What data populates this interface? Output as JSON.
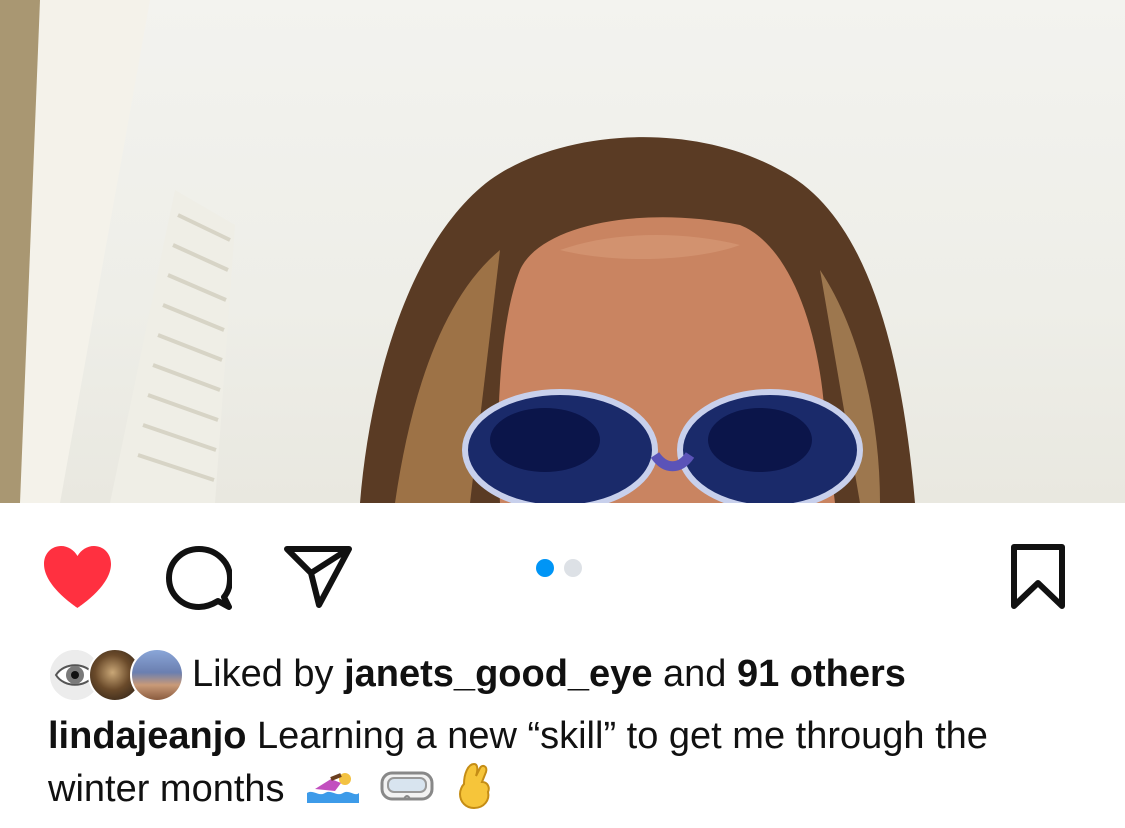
{
  "post": {
    "carousel": {
      "total": 2,
      "active_index": 0
    },
    "liked": true,
    "likes": {
      "prefix": "Liked by",
      "user": "janets_good_eye",
      "connector": "and",
      "others": "91 others"
    },
    "caption": {
      "username": "lindajeanjo",
      "text": "Learning a new “skill” to get me through the winter months"
    }
  },
  "icons": {
    "like": "heart-icon",
    "comment": "comment-icon",
    "share": "paper-plane-icon",
    "save": "bookmark-icon",
    "caption_emojis": [
      "woman-swimming-emoji",
      "goggles-emoji",
      "crossed-fingers-emoji"
    ]
  },
  "colors": {
    "like_red": "#ff3040",
    "carousel_active": "#0095f6",
    "carousel_inactive": "#dde1e6",
    "text": "#111111"
  }
}
